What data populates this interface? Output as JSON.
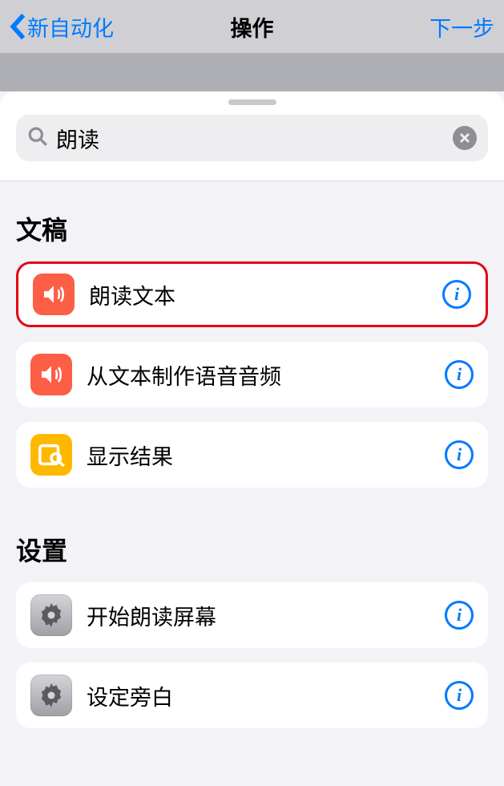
{
  "nav": {
    "back_label": "新自动化",
    "title": "操作",
    "next_label": "下一步"
  },
  "search": {
    "value": "朗读"
  },
  "sections": {
    "documents": {
      "header": "文稿",
      "items": [
        {
          "label": "朗读文本"
        },
        {
          "label": "从文本制作语音音频"
        },
        {
          "label": "显示结果"
        }
      ]
    },
    "settings": {
      "header": "设置",
      "items": [
        {
          "label": "开始朗读屏幕"
        },
        {
          "label": "设定旁白"
        }
      ]
    }
  }
}
